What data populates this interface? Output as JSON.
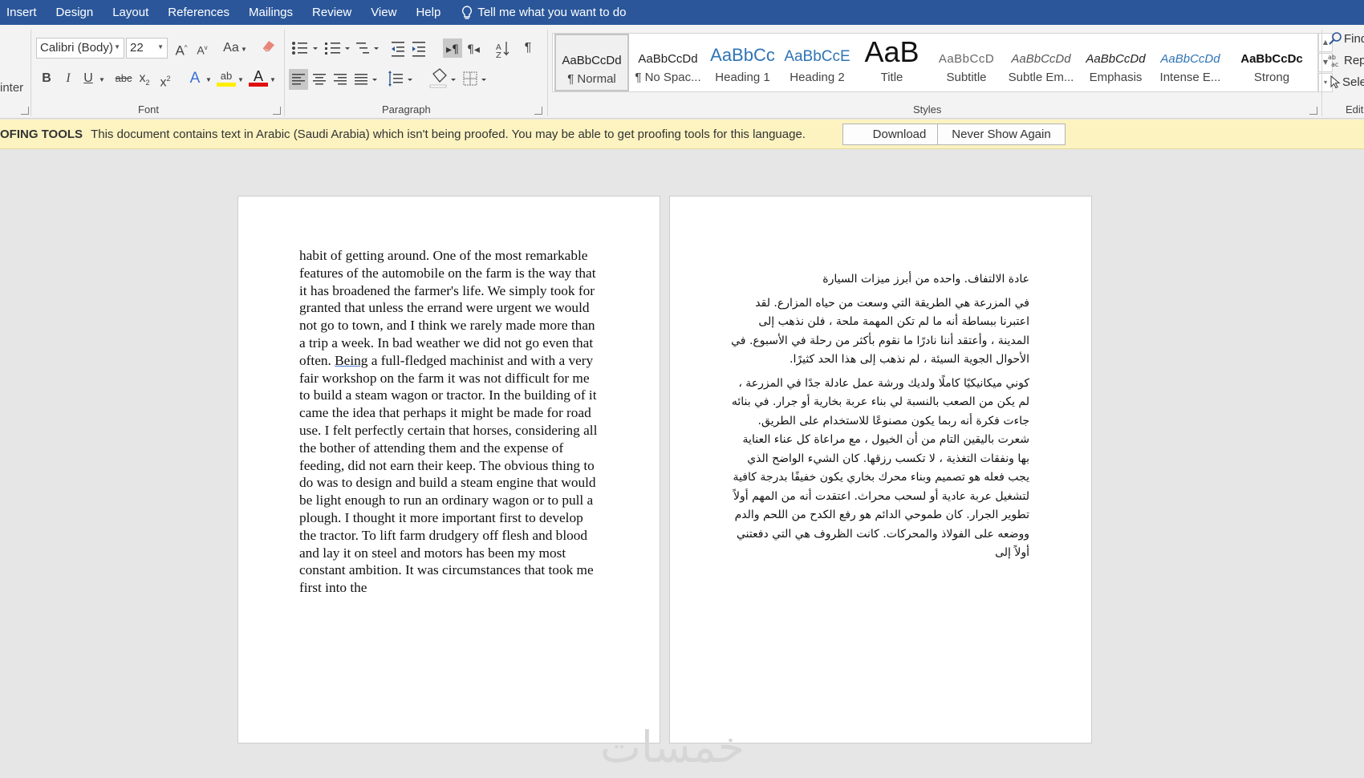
{
  "menu": {
    "items": [
      "Insert",
      "Design",
      "Layout",
      "References",
      "Mailings",
      "Review",
      "View",
      "Help"
    ],
    "tell_me": "Tell me what you want to do"
  },
  "ribbon": {
    "clipboard_fragment": "inter",
    "font": {
      "name": "Calibri (Body)",
      "size": "22",
      "grow_label": "A",
      "shrink_label": "A",
      "case_label": "Aa",
      "bold": "B",
      "italic": "I",
      "underline": "U",
      "strike": "abc",
      "subscript": "x",
      "superscript": "x",
      "effects": "A",
      "highlight": "ab",
      "font_color": "A",
      "group_label": "Font"
    },
    "paragraph": {
      "group_label": "Paragraph",
      "pilcrow": "¶"
    },
    "styles": {
      "group_label": "Styles",
      "items": [
        {
          "preview": "AaBbCcDd",
          "name": "¶ Normal"
        },
        {
          "preview": "AaBbCcDd",
          "name": "¶ No Spac..."
        },
        {
          "preview": "AaBbCc",
          "name": "Heading 1"
        },
        {
          "preview": "AaBbCcE",
          "name": "Heading 2"
        },
        {
          "preview": "AaB",
          "name": "Title"
        },
        {
          "preview": "AaBbCcD",
          "name": "Subtitle"
        },
        {
          "preview": "AaBbCcDd",
          "name": "Subtle Em..."
        },
        {
          "preview": "AaBbCcDd",
          "name": "Emphasis"
        },
        {
          "preview": "AaBbCcDd",
          "name": "Intense E..."
        },
        {
          "preview": "AaBbCcDc",
          "name": "Strong"
        }
      ]
    },
    "editing": {
      "find": "Find",
      "replace": "Rep",
      "select": "Sele",
      "group_label": "Editi"
    }
  },
  "message_bar": {
    "title": "OFING TOOLS",
    "text": "This document contains text in Arabic (Saudi Arabia) which isn't being proofed. You may be able to get proofing tools for this language.",
    "download": "Download",
    "never_show": "Never Show Again"
  },
  "left_page": {
    "text_before": "habit of getting around. One of the most remarkable features of the automobile on the farm is the way that it has broadened the farmer's life. We simply took for granted that unless the errand were urgent we would not go to town, and I think we rarely made more than a trip a week. In bad weather we did not go even that often. ",
    "link_word": "Being",
    "text_after": " a full-fledged machinist and with a very fair workshop on the farm it was not difficult for me to build a steam wagon or tractor. In the building of it came the idea that perhaps it might be made for road use. I felt perfectly certain that horses, considering all the bother of attending them and the expense of feeding, did not earn their keep. The obvious thing to do was to design and build a steam engine that would be light enough to run an ordinary wagon or to pull a plough. I thought it more important first to develop the tractor. To lift farm drudgery off flesh and blood and lay it on steel and motors has been my most constant ambition. It was circumstances that took me first into the"
  },
  "right_page": {
    "paragraphs": [
      "عادة الالتفاف. واحده من أبرز ميزات السيارة",
      "في المزرعة هي الطريقة التي وسعت من حياه المزارع. لقد اعتبرنا ببساطة أنه ما لم تكن المهمة ملحة ، فلن نذهب إلى المدينة ، وأعتقد أننا نادرًا ما نقوم بأكثر من رحلة في الأسبوع. في الأحوال الجوية السيئة ، لم نذهب إلى هذا الحد كثيرًا.",
      "كوني ميكانيكيًا كاملًا ولديك ورشة عمل عادلة جدًا في المزرعة ، لم يكن من الصعب بالنسبة لي بناء عربة بخارية أو جرار. في بنائه جاءت فكرة أنه ربما يكون مصنوعًا للاستخدام على الطريق. شعرت باليقين التام من أن الخيول ، مع مراعاة كل عناء العناية بها ونفقات التغذية ، لا تكسب رزقها. كان الشيء الواضح الذي يجب فعله هو تصميم وبناء محرك بخاري يكون خفيفًا بدرجة كافية لتشغيل عربة عادية أو لسحب محراث. اعتقدت أنه من المهم أولاً تطوير الجرار. كان طموحي الدائم هو رفع الكدح من اللحم والدم ووضعه على الفولاذ والمحركات. كانت الظروف هي التي دفعتني أولاً إلى"
    ]
  },
  "watermark": "خمسات"
}
